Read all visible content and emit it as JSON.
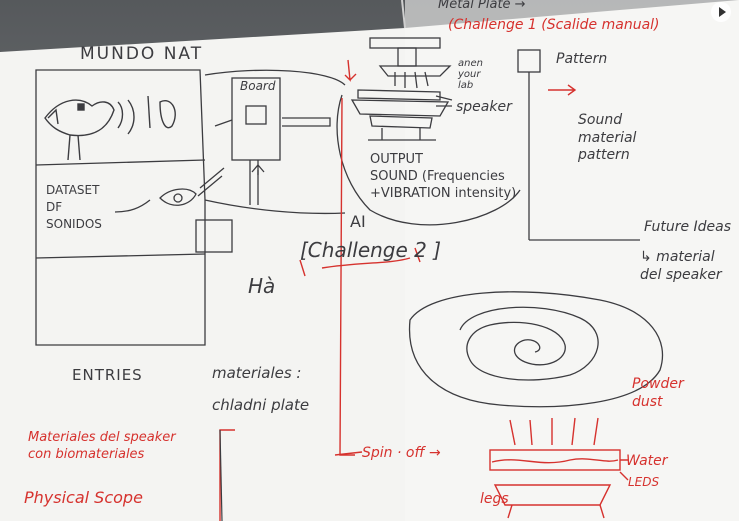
{
  "photo": {
    "whiteboard": {
      "top_right_header": "Metal Plate →",
      "challenge_1": "(Challenge 1 (Scalide manual)",
      "title": "MUNDO NAT",
      "board_label": "Board",
      "pattern_label": "Pattern",
      "label_anen": "anen\nyour\nlab",
      "label_speaker": "speaker",
      "dataset": "DATASET\nDF\nSONIDOS",
      "output": "OUTPUT\nSOUND (Frequencies\n+VIBRATION intensity)",
      "ai": "AI",
      "challenge_2": "[Challenge 2 ]",
      "ha": "Hà",
      "sound_pattern": "Sound\nmaterial\npattern",
      "future_ideas": "Future Ideas",
      "material_speaker": "↳ material\ndel speaker",
      "entries": "ENTRIES",
      "materiales": "materiales :",
      "chladni": "chladni plate",
      "powder_dust": "Powder\ndust",
      "water": "Water",
      "leds": "LEDS",
      "legs": "legs",
      "spin_off": "Spin · off →",
      "materiales_speaker": "Materiales del speaker\ncon biomateriales",
      "physical_scope": "Physical Scope"
    },
    "colors": {
      "marker_red": "#d6322e",
      "pencil_gray": "#3c3c40",
      "paper": "#f4f4f2"
    },
    "icons": [
      "play-icon"
    ]
  }
}
